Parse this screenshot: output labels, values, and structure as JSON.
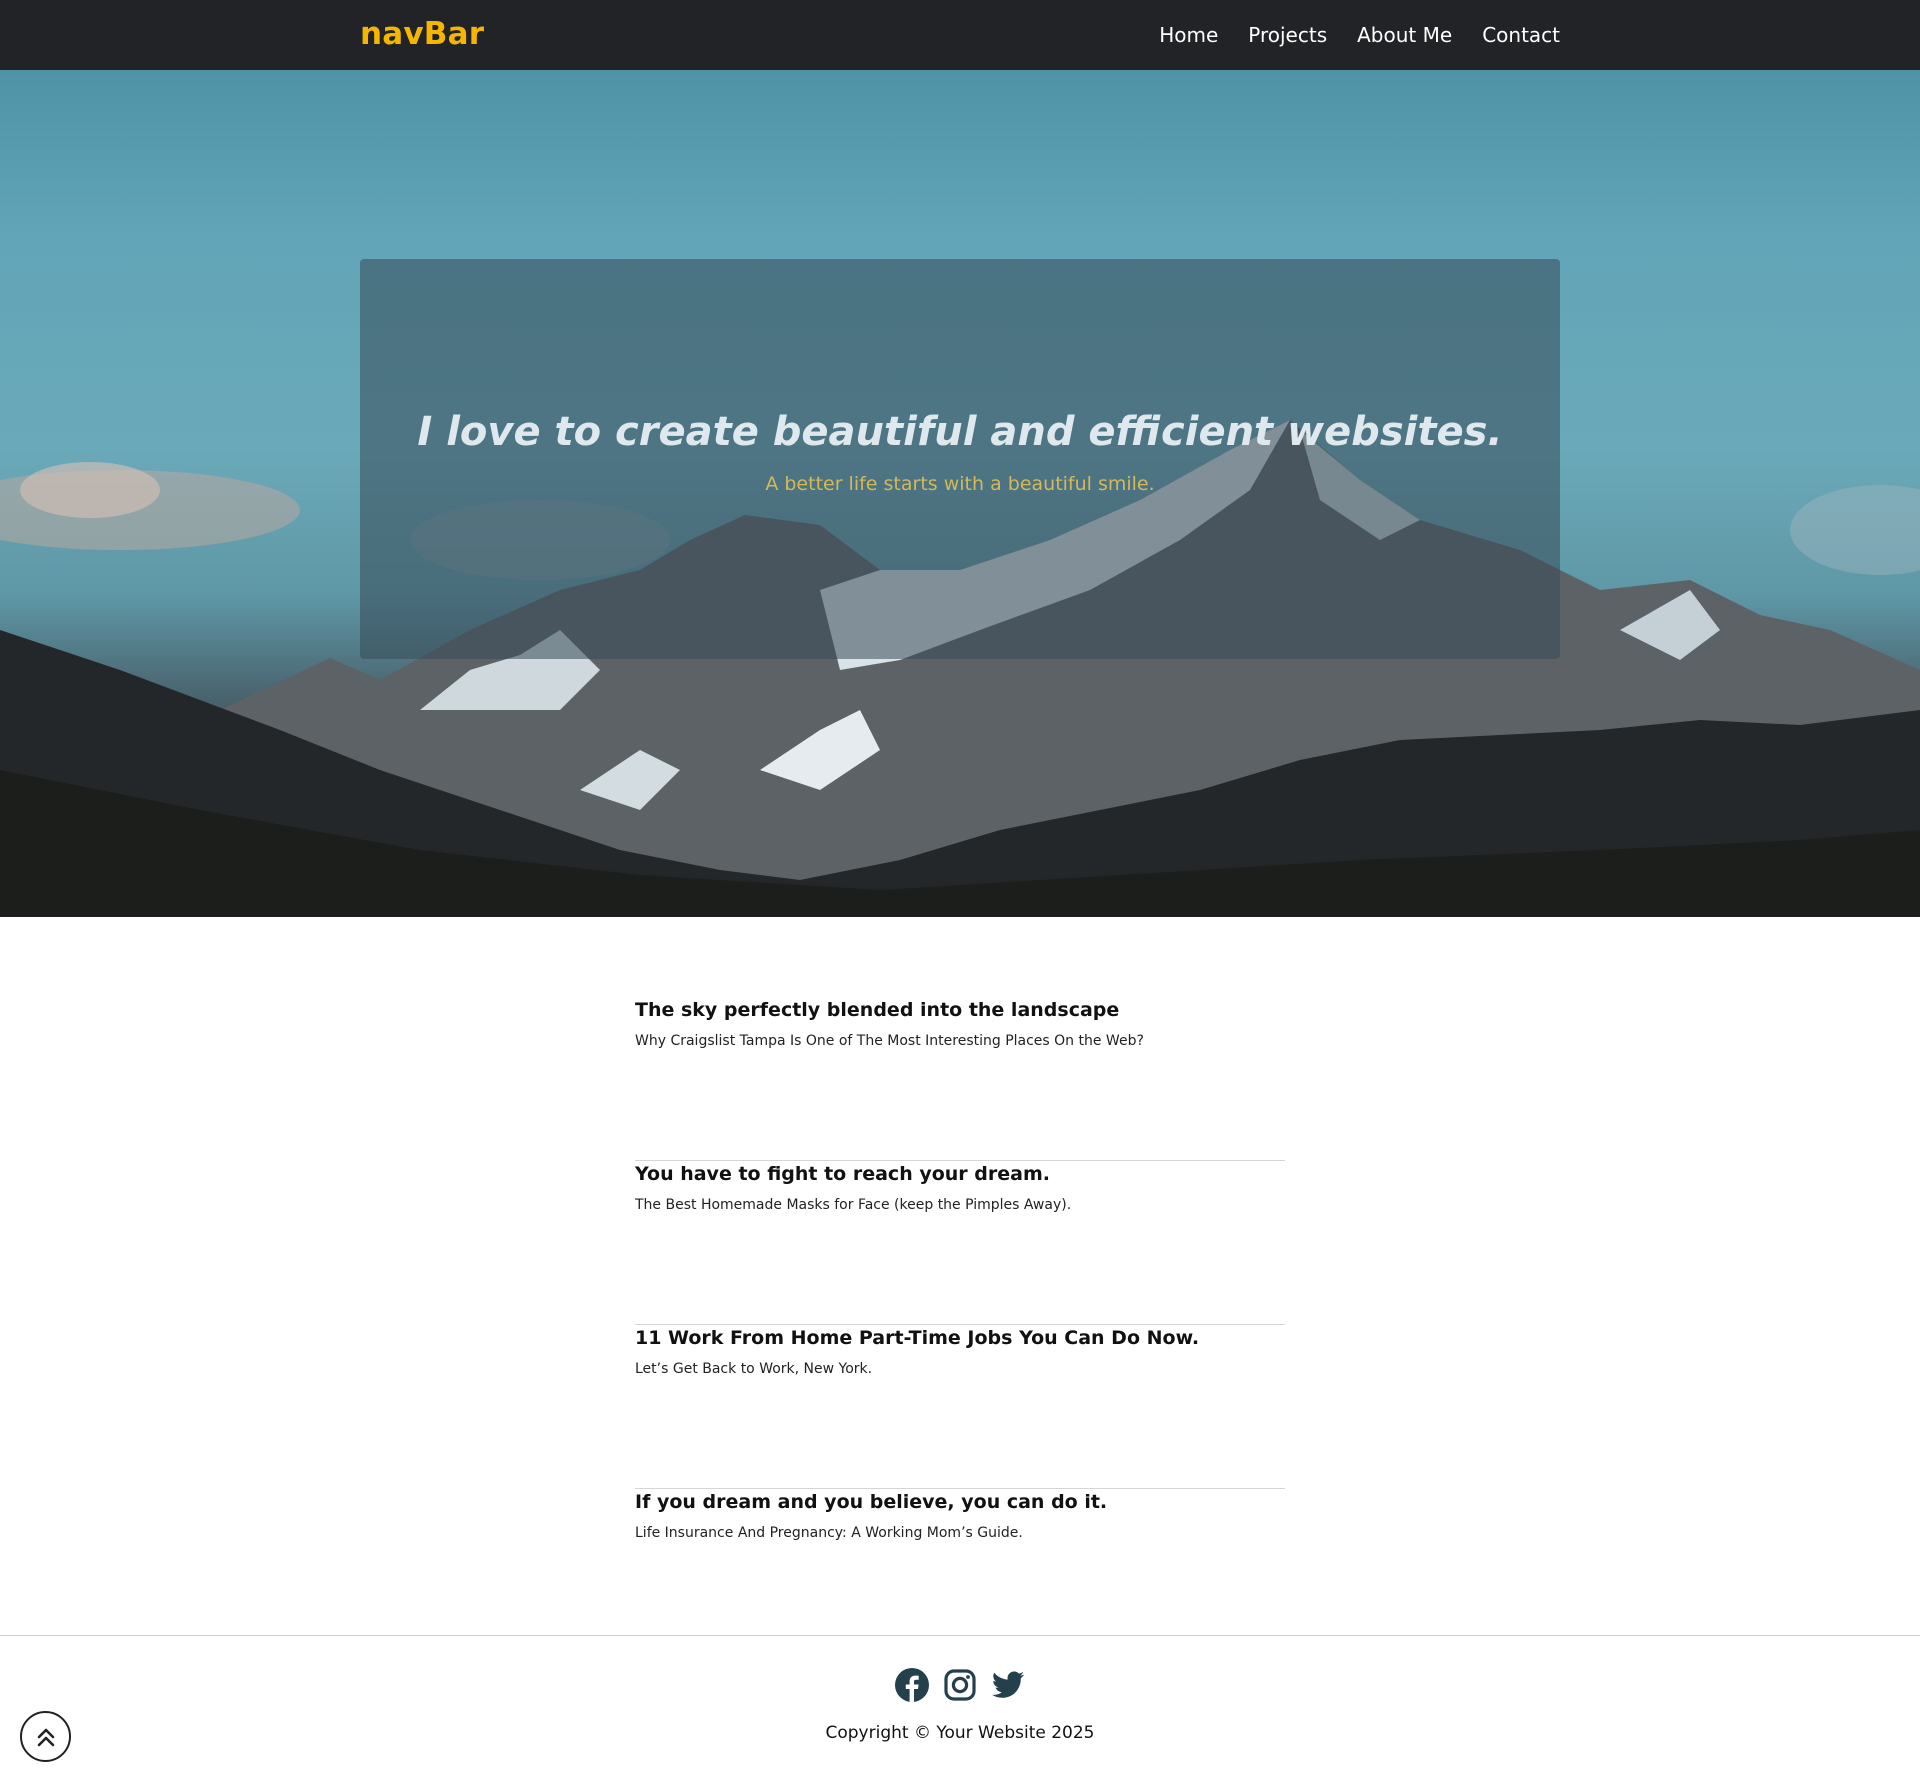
{
  "navbar": {
    "brand": "navBar",
    "links": [
      {
        "label": "Home"
      },
      {
        "label": "Projects"
      },
      {
        "label": "About Me"
      },
      {
        "label": "Contact"
      }
    ]
  },
  "hero": {
    "title": "I love to create beautiful and efficient websites.",
    "subtitle": "A better life starts with a beautiful smile."
  },
  "posts": [
    {
      "title": "The sky perfectly blended into the landscape",
      "subtitle": "Why Craigslist Tampa Is One of The Most Interesting Places On the Web?"
    },
    {
      "title": "You have to fight to reach your dream.",
      "subtitle": "The Best Homemade Masks for Face (keep the Pimples Away)."
    },
    {
      "title": "11 Work From Home Part-Time Jobs You Can Do Now.",
      "subtitle": "Let’s Get Back to Work, New York."
    },
    {
      "title": "If you dream and you believe, you can do it.",
      "subtitle": "Life Insurance And Pregnancy: A Working Mom’s Guide."
    }
  ],
  "footer": {
    "social_icons": [
      "facebook-icon",
      "instagram-icon",
      "twitter-icon"
    ],
    "copyright": "Copyright © Your Website 2025"
  },
  "colors": {
    "navbar_bg": "#222327",
    "brand": "#f5b600",
    "hero_subtitle": "#d4b85a",
    "icon": "#24404c"
  }
}
